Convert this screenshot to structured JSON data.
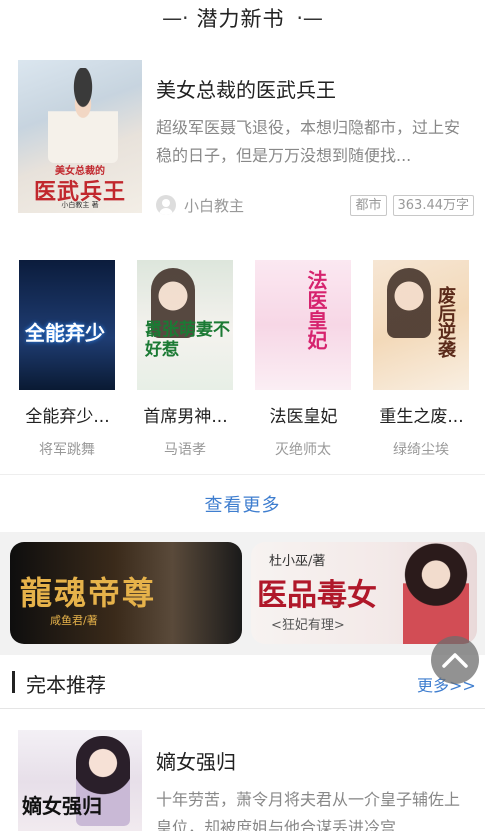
{
  "section1": {
    "title": "潜力新书",
    "dash_left": "—·",
    "dash_right": "·—"
  },
  "featured": {
    "title": "美女总裁的医武兵王",
    "description": "超级军医聂飞退役，本想归隐都市，过上安稳的日子，但是万万没想到随便找...",
    "author": "小白教主",
    "tags": [
      "都市",
      "363.44万字"
    ],
    "cover_line1": "美女总裁的",
    "cover_line2": "医武兵王",
    "cover_line3": "小白教主 著"
  },
  "books": [
    {
      "name": "全能弃少...",
      "author": "将军跳舞",
      "cover_text": "全能弃少"
    },
    {
      "name": "首席男神...",
      "author": "马语孝",
      "cover_text": "嚣张萌妻不好惹"
    },
    {
      "name": "法医皇妃",
      "author": "灭绝师太",
      "cover_text": "法医皇妃"
    },
    {
      "name": "重生之废...",
      "author": "绿绮尘埃",
      "cover_text": "废后逆袭"
    }
  ],
  "see_more": "查看更多",
  "banners": [
    {
      "title": "龍魂帝尊",
      "subtitle": "咸鱼君/著"
    },
    {
      "author": "杜小巫/著",
      "title": "医品毒女",
      "subtitle": "<狂妃有理>"
    }
  ],
  "section2": {
    "title": "完本推荐",
    "more": "更多>>"
  },
  "recommend": {
    "title": "嫡女强归",
    "description": "十年劳苦，萧令月将夫君从一介皇子辅佐上皇位，却被庶姐与他合谋丢进冷宫...",
    "cover_text": "嫡女强归"
  },
  "icons": {
    "scroll_top": "chevron-up-icon",
    "author_avatar": "user-avatar-icon"
  },
  "colors": {
    "link": "#3f7ecf",
    "text": "#222222",
    "muted": "#999999"
  }
}
